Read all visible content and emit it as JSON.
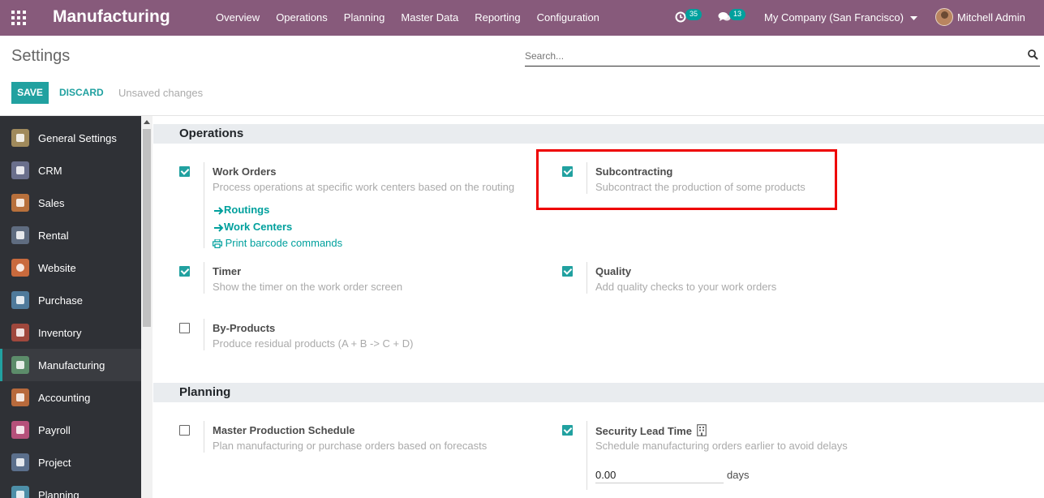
{
  "navbar": {
    "brand": "Manufacturing",
    "menu": [
      "Overview",
      "Operations",
      "Planning",
      "Master Data",
      "Reporting",
      "Configuration"
    ],
    "activity_count": "35",
    "message_count": "13",
    "company": "My Company (San Francisco)",
    "user": "Mitchell Admin"
  },
  "control_panel": {
    "title": "Settings",
    "search_placeholder": "Search...",
    "save_label": "SAVE",
    "discard_label": "DISCARD",
    "unsaved": "Unsaved changes"
  },
  "sidebar": {
    "items": [
      {
        "label": "General Settings",
        "icon": "gear-icon",
        "color": "#a08a5c"
      },
      {
        "label": "CRM",
        "icon": "handshake-icon",
        "color": "#6a6f8c"
      },
      {
        "label": "Sales",
        "icon": "chart-icon",
        "color": "#b8703c"
      },
      {
        "label": "Rental",
        "icon": "rental-icon",
        "color": "#5f6c80"
      },
      {
        "label": "Website",
        "icon": "globe-icon",
        "color": "#c96a3d"
      },
      {
        "label": "Purchase",
        "icon": "purchase-icon",
        "color": "#4f7a9b"
      },
      {
        "label": "Inventory",
        "icon": "inventory-icon",
        "color": "#a0483d"
      },
      {
        "label": "Manufacturing",
        "icon": "wrench-icon",
        "color": "#5c8c6a"
      },
      {
        "label": "Accounting",
        "icon": "accounting-icon",
        "color": "#b86a3c"
      },
      {
        "label": "Payroll",
        "icon": "payroll-icon",
        "color": "#b5507a"
      },
      {
        "label": "Project",
        "icon": "puzzle-icon",
        "color": "#5b6f8c"
      },
      {
        "label": "Planning",
        "icon": "planning-icon",
        "color": "#4d8fa8"
      }
    ]
  },
  "operations": {
    "header": "Operations",
    "work_orders": {
      "label": "Work Orders",
      "desc": "Process operations at specific work centers based on the routing",
      "checked": true,
      "links": [
        "Routings",
        "Work Centers"
      ],
      "print_link": "Print barcode commands"
    },
    "subcontracting": {
      "label": "Subcontracting",
      "desc": "Subcontract the production of some products",
      "checked": true
    },
    "timer": {
      "label": "Timer",
      "desc": "Show the timer on the work order screen",
      "checked": true
    },
    "quality": {
      "label": "Quality",
      "desc": "Add quality checks to your work orders",
      "checked": true
    },
    "by_products": {
      "label": "By-Products",
      "desc": "Produce residual products (A + B -> C + D)",
      "checked": false
    }
  },
  "planning": {
    "header": "Planning",
    "mps": {
      "label": "Master Production Schedule",
      "desc": "Plan manufacturing or purchase orders based on forecasts",
      "checked": false
    },
    "security_lead_time": {
      "label": "Security Lead Time",
      "desc": "Schedule manufacturing orders earlier to avoid delays",
      "checked": true,
      "value": "0.00",
      "unit": "days"
    }
  },
  "colors": {
    "navbar": "#875a7b",
    "accent": "#21a1a0",
    "highlight": "#e00000"
  }
}
